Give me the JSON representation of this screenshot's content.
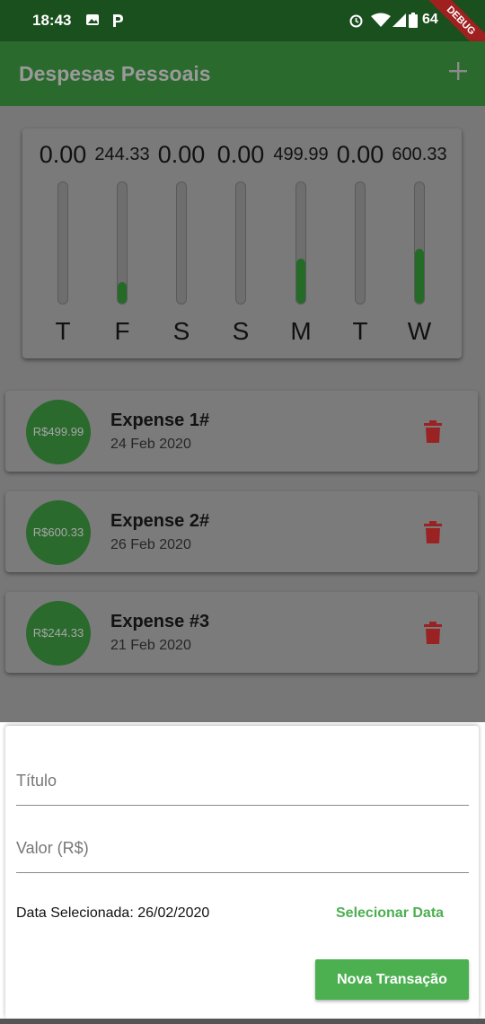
{
  "status_bar": {
    "time": "18:43",
    "battery": "64",
    "debug_label": "DEBUG"
  },
  "app_bar": {
    "title": "Despesas Pessoais",
    "add_icon": "plus-icon"
  },
  "chart": {
    "bars": [
      {
        "day": "T",
        "value": "0.00",
        "fill": 0.0
      },
      {
        "day": "F",
        "value": "244.33",
        "fill": 0.18
      },
      {
        "day": "S",
        "value": "0.00",
        "fill": 0.0
      },
      {
        "day": "S",
        "value": "0.00",
        "fill": 0.0
      },
      {
        "day": "M",
        "value": "499.99",
        "fill": 0.37
      },
      {
        "day": "T",
        "value": "0.00",
        "fill": 0.0
      },
      {
        "day": "W",
        "value": "600.33",
        "fill": 0.45
      }
    ]
  },
  "transactions": [
    {
      "amount": "R$499.99",
      "title": "Expense 1#",
      "date": "24 Feb 2020"
    },
    {
      "amount": "R$600.33",
      "title": "Expense 2#",
      "date": "26 Feb 2020"
    },
    {
      "amount": "R$244.33",
      "title": "Expense #3",
      "date": "21 Feb 2020"
    }
  ],
  "form": {
    "title_placeholder": "Título",
    "value_placeholder": "Valor (R$)",
    "date_label": "Data Selecionada: 26/02/2020",
    "select_date": "Selecionar Data",
    "submit": "Nova Transação"
  },
  "colors": {
    "primary": "#4caf50",
    "dark_green": "#2a6a2d",
    "danger": "#b71c1c"
  }
}
